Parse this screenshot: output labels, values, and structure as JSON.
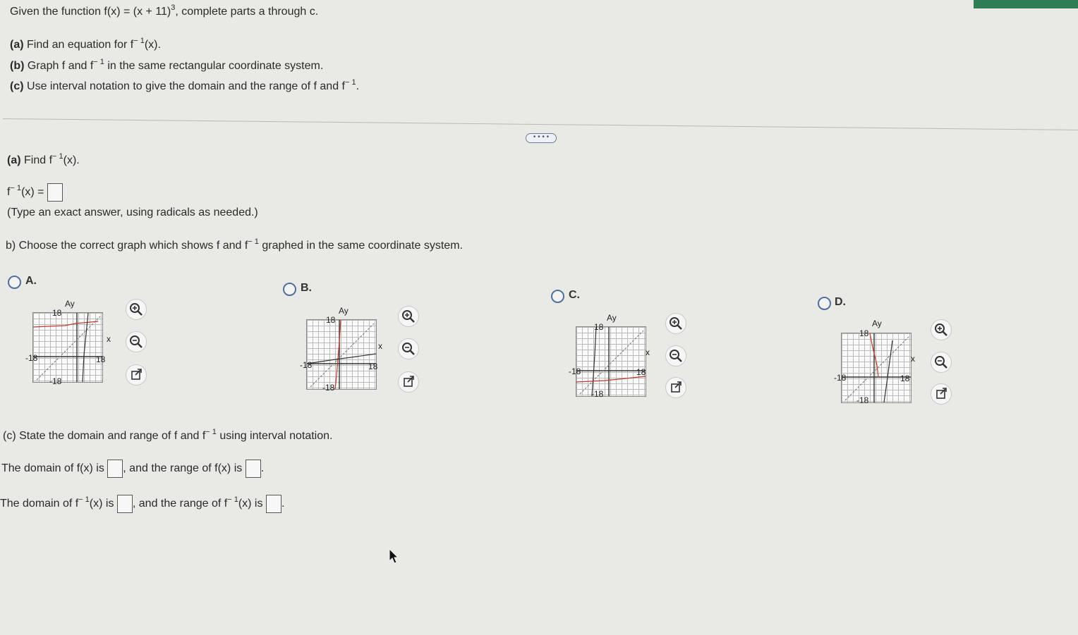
{
  "problem": {
    "intro_pre": "Given the function f(x) = (x + 11)",
    "intro_exp": "3",
    "intro_post": ", complete parts a through c.",
    "a_letter": "(a)",
    "a_pre": "Find an equation for f",
    "a_exp": "− 1",
    "a_post": "(x).",
    "b_letter": "(b)",
    "b_pre": "Graph f and f",
    "b_exp": "− 1",
    "b_post": "in the same rectangular coordinate system.",
    "c_letter": "(c)",
    "c_pre": "Use interval notation to give the domain and the range of f and f",
    "c_exp": "− 1",
    "c_post": "."
  },
  "more_button": "• • • •",
  "part_a": {
    "letter": "(a)",
    "pre": "Find f",
    "exp": "− 1",
    "post": "(x).",
    "answer_pre": "f",
    "answer_exp": "− 1",
    "answer_post": "(x) =",
    "hint": "(Type an exact answer, using radicals as needed.)"
  },
  "part_b": {
    "pre": "b) Choose the correct graph which shows f and f",
    "exp": "− 1",
    "post": "graphed in the same coordinate system.",
    "options": [
      {
        "label": "A.",
        "tick_top": "18",
        "tick_left": "-18",
        "tick_right": "18",
        "tick_bottom": "-18",
        "y_label": "Ay",
        "x_label": "x"
      },
      {
        "label": "B.",
        "tick_top": "18",
        "tick_left": "-18",
        "tick_right": "18",
        "tick_bottom": "-18",
        "y_label": "Ay",
        "x_label": "x"
      },
      {
        "label": "C.",
        "tick_top": "18",
        "tick_left": "-18",
        "tick_right": "18",
        "tick_bottom": "-18",
        "y_label": "Ay",
        "x_label": "x"
      },
      {
        "label": "D.",
        "tick_top": "18",
        "tick_left": "-18",
        "tick_right": "18",
        "tick_bottom": "-18",
        "y_label": "Ay",
        "x_label": "x"
      }
    ]
  },
  "part_c": {
    "pre": "(c) State the domain and range of f and f",
    "exp": "− 1",
    "post": "using interval notation.",
    "line1_a": "The domain of f(x) is",
    "line1_b": ", and the range of f(x) is",
    "line1_c": ".",
    "line2_a": "The domain of f",
    "line2_exp": "− 1",
    "line2_b": "(x) is",
    "line2_c": ", and the range of f",
    "line2_exp2": "− 1",
    "line2_d": "(x) is",
    "line2_e": "."
  },
  "colors": {
    "accent": "#2e7d54",
    "radio": "#4f6f9f",
    "curve_red": "#c0392b"
  },
  "icons": [
    "zoom-in-icon",
    "zoom-out-icon",
    "external-link-icon"
  ]
}
